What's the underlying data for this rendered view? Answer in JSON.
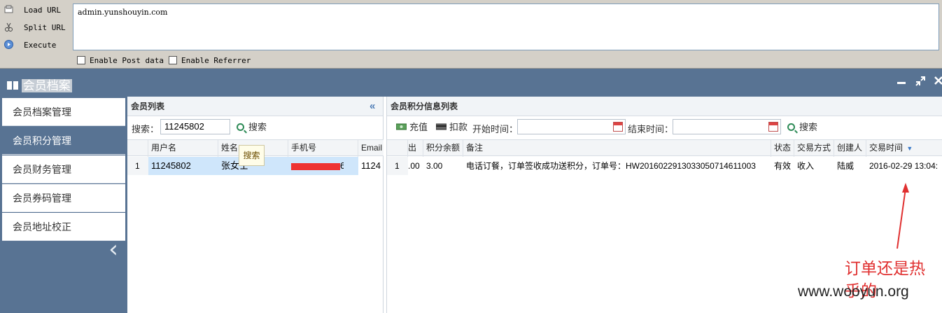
{
  "hackbar": {
    "buttons": [
      {
        "label": "Load URL",
        "icon": "load-icon"
      },
      {
        "label": "Split URL",
        "icon": "scissors-icon"
      },
      {
        "label": "Execute",
        "icon": "play-icon"
      }
    ],
    "url_value": "admin.yunshouyin.com",
    "enable_post": "Enable Post data",
    "enable_referrer": "Enable Referrer"
  },
  "app": {
    "title": "会员档案",
    "header_icons": [
      "minimize-icon",
      "restore-icon",
      "close-icon"
    ]
  },
  "sidebar": {
    "items": [
      {
        "label": "会员档案管理",
        "active": false
      },
      {
        "label": "会员积分管理",
        "active": true
      },
      {
        "label": "会员财务管理",
        "active": false
      },
      {
        "label": "会员券码管理",
        "active": false
      },
      {
        "label": "会员地址校正",
        "active": false
      }
    ]
  },
  "member_list": {
    "title": "会员列表",
    "collapse_glyph": "«",
    "search_label": "搜索：",
    "search_value": "11245802",
    "search_button": "搜索",
    "tooltip": "搜索",
    "columns": [
      "用户名",
      "姓名",
      "手机号",
      "Email"
    ],
    "rows": [
      {
        "index": "1",
        "username": "11245802",
        "name": "张女士",
        "phone": "6",
        "email": "1124"
      }
    ]
  },
  "points_list": {
    "title": "会员积分信息列表",
    "recharge_label": "充值",
    "deduct_label": "扣款",
    "start_label": "开始时间：",
    "end_label": "结束时间：",
    "search_button": "搜索",
    "columns": [
      "支出",
      "积分余额",
      "备注",
      "状态",
      "交易方式",
      "创建人",
      "交易时间"
    ],
    "rows": [
      {
        "index": "1",
        "expense": ".00",
        "balance": "3.00",
        "note": "电话订餐，订单签收成功送积分，订单号：HW2016022913033050714611003",
        "status": "有效",
        "method": "收入",
        "creator": "陆威",
        "time": "2016-02-29 13:04:"
      }
    ]
  },
  "annotation": {
    "text_line1": "订单还是热",
    "text_line2": "乎的",
    "color": "#e03030"
  },
  "watermark": "www.wooyun.org"
}
